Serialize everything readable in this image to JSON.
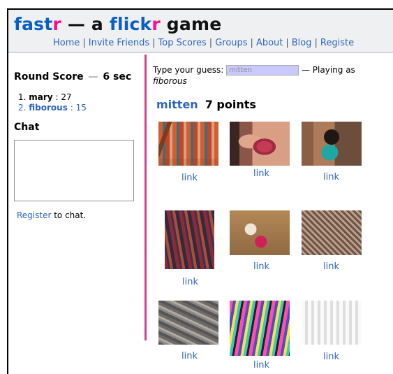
{
  "header": {
    "logo_part1": "fast",
    "logo_part2": "r",
    "logo_part3": " — a ",
    "logo_part4": "flick",
    "logo_part5": "r",
    "logo_part6": " game"
  },
  "nav": {
    "items": [
      "Home",
      "Invite Friends",
      "Top Scores",
      "Groups",
      "About",
      "Blog",
      "Registe"
    ]
  },
  "sidebar": {
    "round_label": "Round Score",
    "round_time": "6 sec",
    "scores": [
      {
        "rank": "1.",
        "name": "mary",
        "points": "27"
      },
      {
        "rank": "2.",
        "name": "fiborous",
        "points": "15"
      }
    ],
    "chat_title": "Chat",
    "register_link": "Register",
    "register_text": " to chat."
  },
  "game": {
    "guess_label": "Type your guess:",
    "guess_value": "mitten",
    "playing_as_text": "— Playing as",
    "playing_as_name": "fiborous",
    "player_name": "mitten",
    "player_points": "7 points",
    "photo_links": [
      "link",
      "link",
      "link",
      "link",
      "link",
      "link",
      "link",
      "link",
      "link"
    ]
  },
  "colors": {
    "accent_blue": "#2e66bf",
    "accent_pink": "#ff0b8c",
    "divider": "#d5408f",
    "guess_bg": "#c9c8ff"
  }
}
